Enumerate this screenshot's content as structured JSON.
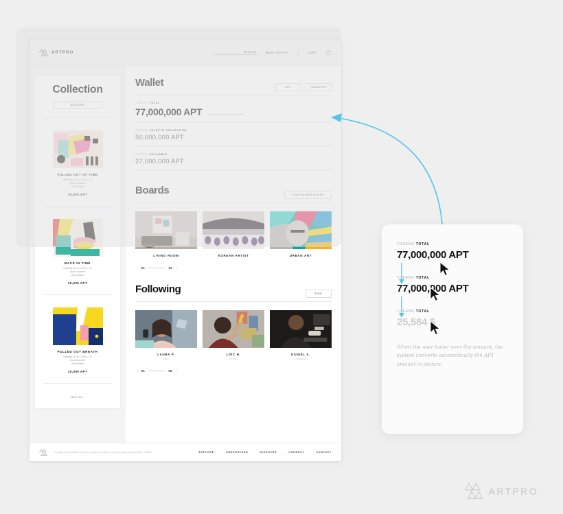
{
  "canvas": {
    "background": "#efefef",
    "accent_blue": "#57c4ea"
  },
  "site": {
    "brand": "ARTPRO",
    "nav": {
      "search_label": "SEARCH",
      "account_label": "MARY DUPONT",
      "cart_label": "CART"
    },
    "footer": {
      "legal": "A private limited liability company registered in Malta. Company Registration Number: C89507",
      "links": [
        "EXPLORE",
        "UNDERSTAND",
        "DISCOVER",
        "CONNECT",
        "CONTACT"
      ]
    }
  },
  "collection": {
    "title": "Collection",
    "manage_button": "MANAGE",
    "see_all": "SEE ALL",
    "items": [
      {
        "name": "PULLED OUT OF TIME",
        "meta1": "Paintings, 30 W x 36 H x 1 in",
        "meta2": "Jackie Odonnell",
        "meta3": "United States",
        "price": "30,000 APT",
        "palette": [
          "#f3c9d6",
          "#f5df6a",
          "#78c9c0",
          "#e46aa0",
          "#2b2b2b",
          "#ffffff"
        ]
      },
      {
        "name": "BACK IN TIME",
        "meta1": "Paintings, 30 W x 36 H x 1 in",
        "meta2": "Jackie Odonnell",
        "meta3": "United States",
        "price": "15,000 APT",
        "palette": [
          "#e8453c",
          "#f4e04d",
          "#35b0a0",
          "#f4a6b8",
          "#ffffff",
          "#1c1c1c"
        ]
      },
      {
        "name": "PULLED OUT BREATH",
        "meta1": "Paintings, 30 W x 36 H x 1 in",
        "meta2": "Marie Odonnell",
        "meta3": "United States",
        "price": "10,000 APT",
        "palette": [
          "#f7d820",
          "#1f3f8f",
          "#f2a0ab",
          "#ffffff",
          "#122a63"
        ]
      }
    ]
  },
  "wallet": {
    "title": "Wallet",
    "buy_button": "BUY",
    "transfer_button": "TRANSFER",
    "rows": [
      {
        "label_prefix": "TOKENS ",
        "label_strong": "TOTAL",
        "value": "77,000,000 APT",
        "hint": "Hover to see the value in dollars",
        "size": "big"
      },
      {
        "label_prefix": "TOKENS ",
        "label_strong": "VALUE IN COLLECTION",
        "value": "50,000,000 APT",
        "hint": "",
        "size": "mid"
      },
      {
        "label_prefix": "TOKENS ",
        "label_strong": "AVAILABLE",
        "value": "27,000,000 APT",
        "hint": "",
        "size": "mid"
      }
    ]
  },
  "boards": {
    "title": "Boards",
    "create_button": "CREATE NEW BOARD",
    "items": [
      {
        "caption": "LIVING ROOM",
        "sub": ""
      },
      {
        "caption": "KOREAN ARTIST",
        "sub": ""
      },
      {
        "caption": "URBAN ART",
        "sub": ""
      }
    ],
    "pager": {
      "prev": "‹",
      "current": "01",
      "total": "12",
      "next": "›"
    }
  },
  "following": {
    "title": "Following",
    "find_button": "FIND",
    "items": [
      {
        "caption": "LAURA P.",
        "sub": "Artist"
      },
      {
        "caption": "LOÏC H.",
        "sub": "Curator"
      },
      {
        "caption": "DANIEL S.",
        "sub": "Collector"
      }
    ],
    "pager": {
      "prev": "‹",
      "current": "01",
      "total": "08",
      "next": "›"
    }
  },
  "callout": {
    "blocks": [
      {
        "label_prefix": "TOKENS ",
        "label_strong": "TOTAL",
        "value": "77,000,000 APT",
        "state": "normal"
      },
      {
        "label_prefix": "TOKENS ",
        "label_strong": "TOTAL",
        "value": "77,000,000 APT",
        "state": "normal"
      },
      {
        "label_prefix": "TOKENS ",
        "label_strong": "TOTAL",
        "value": "25,584 $",
        "state": "muted"
      }
    ],
    "note": "When the user hover over the amount, the system converts automatically the APT amount in dollars."
  },
  "corner_logo": {
    "word": "ARTPRO"
  }
}
